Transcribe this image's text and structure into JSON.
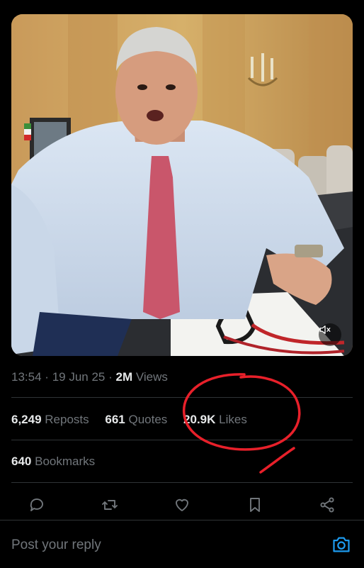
{
  "video": {
    "description_icon": "muted-speaker-icon"
  },
  "meta": {
    "time": "13:54",
    "date": "19 Jun 25",
    "views_count": "2M",
    "views_label": "Views",
    "sep": "·"
  },
  "stats": {
    "reposts_count": "6,249",
    "reposts_label": "Reposts",
    "quotes_count": "661",
    "quotes_label": "Quotes",
    "likes_count": "20.9K",
    "likes_label": "Likes"
  },
  "bookmarks": {
    "count": "640",
    "label": "Bookmarks"
  },
  "actions": {
    "reply_icon": "reply-icon",
    "repost_icon": "repost-icon",
    "like_icon": "heart-icon",
    "bookmark_icon": "bookmark-icon",
    "share_icon": "share-icon"
  },
  "reply": {
    "placeholder": "Post your reply",
    "camera_icon": "camera-icon"
  },
  "colors": {
    "background": "#000000",
    "text_primary": "#e7e9ea",
    "text_secondary": "#71767b",
    "divider": "#2f3336",
    "accent_blue": "#1d9bf0",
    "annotation_red": "#e8202a"
  }
}
